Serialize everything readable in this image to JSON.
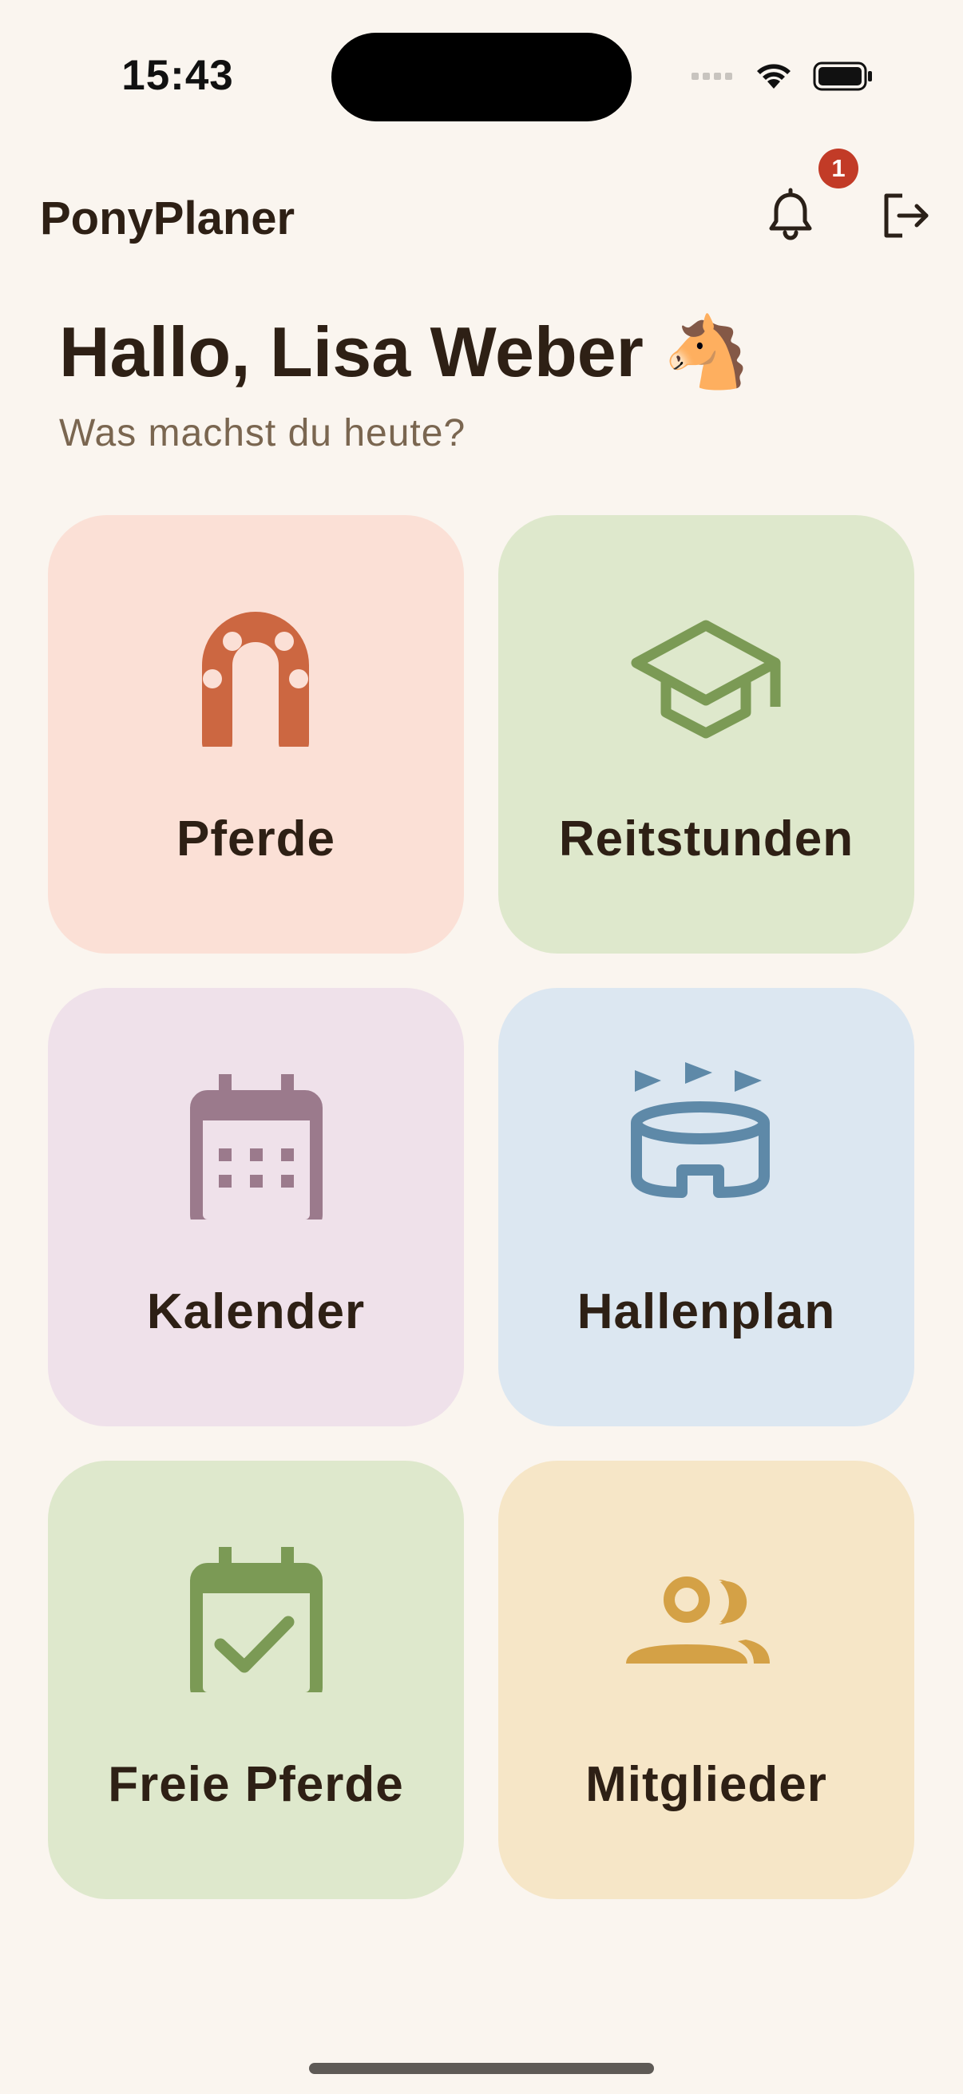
{
  "status_bar": {
    "time": "15:43"
  },
  "app_bar": {
    "title": "PonyPlaner",
    "notification_count": "1"
  },
  "greeting": {
    "headline": "Hallo, Lisa Weber 🐴",
    "subtitle": "Was machst du heute?"
  },
  "tiles": [
    {
      "label": "Pferde",
      "icon": "horseshoe-icon",
      "bg": "#FBE0D6",
      "fg": "#CC6741"
    },
    {
      "label": "Reitstunden",
      "icon": "graduation-cap-icon",
      "bg": "#DEE8CC",
      "fg": "#7B9A55"
    },
    {
      "label": "Kalender",
      "icon": "calendar-icon",
      "bg": "#EFE1EA",
      "fg": "#9B7A8C"
    },
    {
      "label": "Hallenplan",
      "icon": "arena-icon",
      "bg": "#DCE7F1",
      "fg": "#5E89A8"
    },
    {
      "label": "Freie Pferde",
      "icon": "calendar-check-icon",
      "bg": "#DEE8CC",
      "fg": "#7B9A55"
    },
    {
      "label": "Mitglieder",
      "icon": "members-icon",
      "bg": "#F6E6C7",
      "fg": "#D4A146"
    }
  ],
  "colors": {
    "background": "#FAF5EF",
    "text": "#2E2015",
    "badge": "#C23B27"
  }
}
